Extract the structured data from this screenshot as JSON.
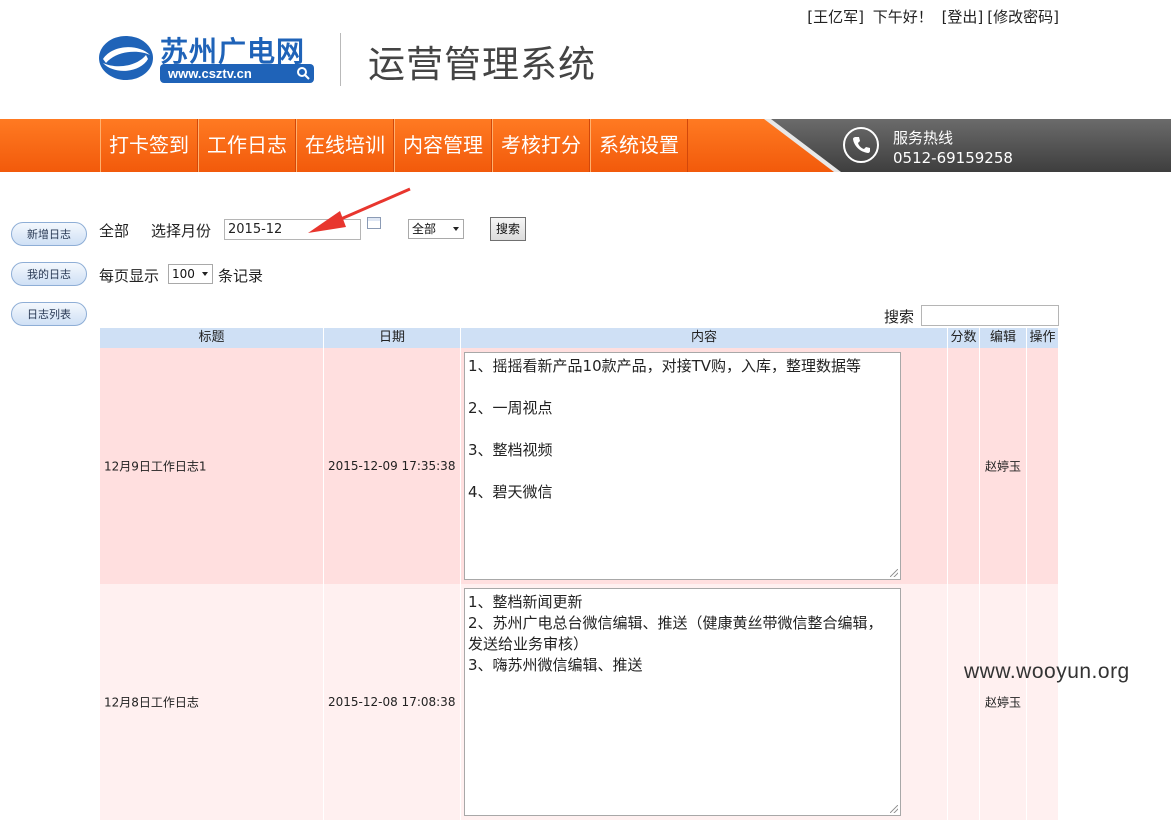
{
  "header": {
    "logo_text": "苏州广电网",
    "logo_url": "www.csztv.cn",
    "system_title": "运营管理系统",
    "user": {
      "name": "[王亿军]",
      "greeting": "下午好！",
      "logout": "[登出]",
      "change_password": "[修改密码]"
    }
  },
  "nav": {
    "items": [
      {
        "label": "打卡签到"
      },
      {
        "label": "工作日志"
      },
      {
        "label": "在线培训"
      },
      {
        "label": "内容管理"
      },
      {
        "label": "考核打分"
      },
      {
        "label": "系统设置"
      }
    ],
    "hotline_title": "服务热线",
    "hotline_number": "0512-69159258"
  },
  "sidebar": {
    "items": [
      {
        "label": "新增日志"
      },
      {
        "label": "我的日志"
      },
      {
        "label": "日志列表"
      }
    ]
  },
  "filters": {
    "all_label": "全部",
    "month_label": "选择月份",
    "month_value": "2015-12",
    "scope_select": "全部",
    "search_button": "搜索",
    "per_page_label": "每页显示",
    "per_page_value": "100",
    "records_label": "条记录"
  },
  "table_search_label": "搜索",
  "table": {
    "columns": [
      "标题",
      "日期",
      "内容",
      "分数",
      "编辑",
      "操作"
    ],
    "rows": [
      {
        "title": "12月9日工作日志1",
        "date": "2015-12-09 17:35:38",
        "content": [
          "1、摇摇看新产品10款产品，对接TV购，入库，整理数据等",
          "",
          "2、一周视点",
          "",
          "3、整档视频",
          "",
          "4、碧天微信"
        ],
        "score": "",
        "editor": "赵婷玉",
        "action": ""
      },
      {
        "title": "12月8日工作日志",
        "date": "2015-12-08 17:08:38",
        "content": [
          "1、整档新闻更新",
          "2、苏州广电总台微信编辑、推送（健康黄丝带微信整合编辑，发送给业务审核）",
          "3、嗨苏州微信编辑、推送"
        ],
        "score": "",
        "editor": "赵婷玉",
        "action": ""
      }
    ]
  },
  "watermark": "www.wooyun.org",
  "colors": {
    "nav_orange": "#f66410",
    "logo_blue": "#1f63b8",
    "header_blue": "#cfe0f5",
    "row_pink": "#ffdfdf",
    "row_light": "#fff0f0",
    "arrow_red": "#e8362e"
  }
}
